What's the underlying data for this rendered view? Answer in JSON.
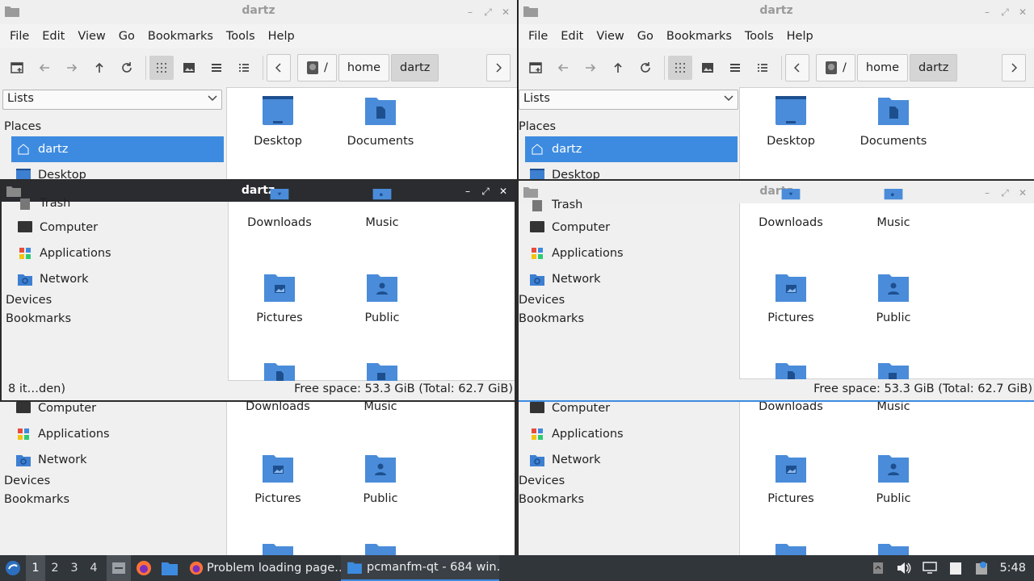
{
  "windows": [
    {
      "title": "dartz",
      "active": false,
      "menu": [
        "File",
        "Edit",
        "View",
        "Go",
        "Bookmarks",
        "Tools",
        "Help"
      ],
      "path": {
        "root": "/",
        "segments": [
          "home",
          "dartz"
        ]
      },
      "side_combo": "Lists",
      "sections": {
        "places": "Places",
        "devices": "Devices",
        "bookmarks": "Bookmarks"
      },
      "places": [
        "dartz",
        "Desktop"
      ],
      "files": [
        "Desktop",
        "Documents"
      ]
    },
    {
      "title": "dartz",
      "active": false,
      "menu": [
        "File",
        "Edit",
        "View",
        "Go",
        "Bookmarks",
        "Tools",
        "Help"
      ],
      "path": {
        "root": "/",
        "segments": [
          "home",
          "dartz"
        ]
      },
      "side_combo": "Lists",
      "sections": {
        "places": "Places",
        "devices": "Devices",
        "bookmarks": "Bookmarks"
      },
      "places": [
        "dartz",
        "Desktop"
      ],
      "files": [
        "Desktop",
        "Documents"
      ]
    },
    {
      "title": "dartz",
      "active": true,
      "places": [
        "Trash",
        "Computer",
        "Applications",
        "Network"
      ],
      "sections": {
        "devices": "Devices",
        "bookmarks": "Bookmarks"
      },
      "files": [
        "Downloads",
        "Music",
        "Pictures",
        "Public"
      ],
      "status_left": "8 it…den)",
      "status_right": "Free space: 53.3 GiB (Total: 62.7 GiB)"
    },
    {
      "title": "dartz",
      "active": false,
      "places": [
        "Trash",
        "Computer",
        "Applications",
        "Network"
      ],
      "sections": {
        "devices": "Devices",
        "bookmarks": "Bookmarks"
      },
      "files": [
        "Downloads",
        "Music",
        "Pictures",
        "Public"
      ],
      "status_right": "Free space: 53.3 GiB (Total: 62.7 GiB)"
    },
    {
      "places": [
        "Computer",
        "Applications",
        "Network"
      ],
      "sections": {
        "devices": "Devices",
        "bookmarks": "Bookmarks"
      },
      "files": [
        "Downloads",
        "Music",
        "Pictures",
        "Public"
      ]
    },
    {
      "places": [
        "Computer",
        "Applications",
        "Network"
      ],
      "sections": {
        "devices": "Devices",
        "bookmarks": "Bookmarks"
      },
      "files": [
        "Downloads",
        "Music",
        "Pictures",
        "Public"
      ]
    }
  ],
  "taskbar": {
    "workspaces": [
      "1",
      "2",
      "3",
      "4"
    ],
    "tasks": [
      "Problem loading page…",
      "pcmanfm-qt - 684 win…"
    ],
    "clock": "5:48"
  },
  "colors": {
    "accent": "#3d8be0",
    "folder": "#4a8cd9",
    "folder_dark": "#1d4f8f",
    "panel": "#31363b"
  }
}
